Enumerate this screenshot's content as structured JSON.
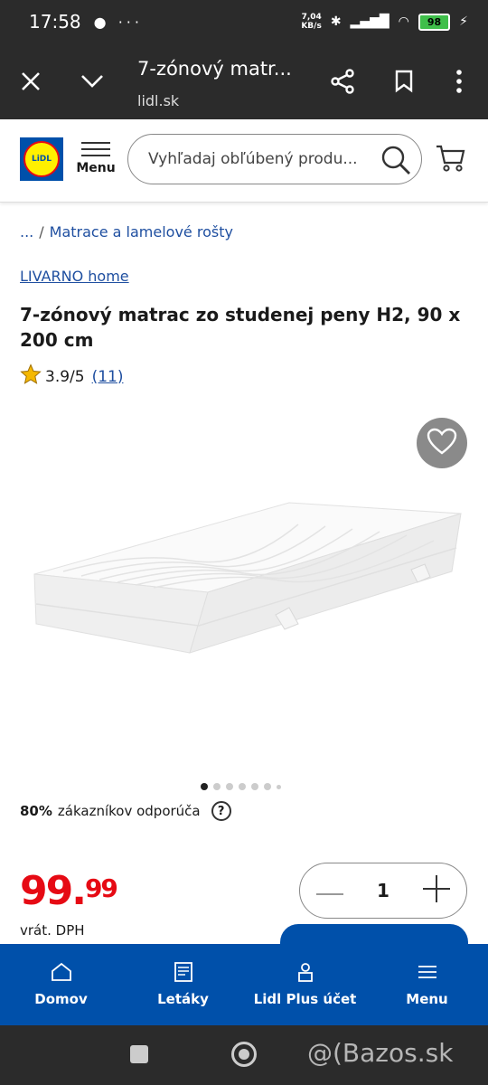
{
  "status_bar": {
    "time": "17:58",
    "left_icons": "● ···",
    "net_speed_value": "7,04",
    "net_speed_unit": "KB/s",
    "battery": "98"
  },
  "browser": {
    "page_title": "7-zónový matr...",
    "host": "lidl.sk"
  },
  "header": {
    "logo_text": "LiDL",
    "menu_label": "Menu",
    "search_placeholder": "Vyhľadaj obľúbený produ..."
  },
  "breadcrumb": {
    "ellipsis": "...",
    "separator": "/",
    "category": "Matrace a lamelové rošty"
  },
  "product": {
    "brand": "LIVARNO home",
    "title": "7-zónový matrac zo studenej peny H2, 90 x 200 cm",
    "rating": "3.9/5",
    "rating_count": "(11)",
    "recommend_percent": "80%",
    "recommend_text": "zákazníkov odporúča",
    "help": "?",
    "price_int": "99.",
    "price_dec": "99",
    "vat_note": "vrát. DPH",
    "quantity": "1"
  },
  "carousel": {
    "dot_count": 7,
    "active_index": 0
  },
  "bottom_nav": [
    {
      "label": "Domov",
      "icon": "home-icon"
    },
    {
      "label": "Letáky",
      "icon": "leaflet-icon"
    },
    {
      "label": "Lidl Plus účet",
      "icon": "user-icon"
    },
    {
      "label": "Menu",
      "icon": "menu-icon"
    }
  ],
  "watermark": "@(Bazos.sk",
  "colors": {
    "lidl_blue": "#0050aa",
    "lidl_red": "#e60a14",
    "lidl_yellow": "#fff000",
    "link_blue": "#1f4fa0"
  }
}
